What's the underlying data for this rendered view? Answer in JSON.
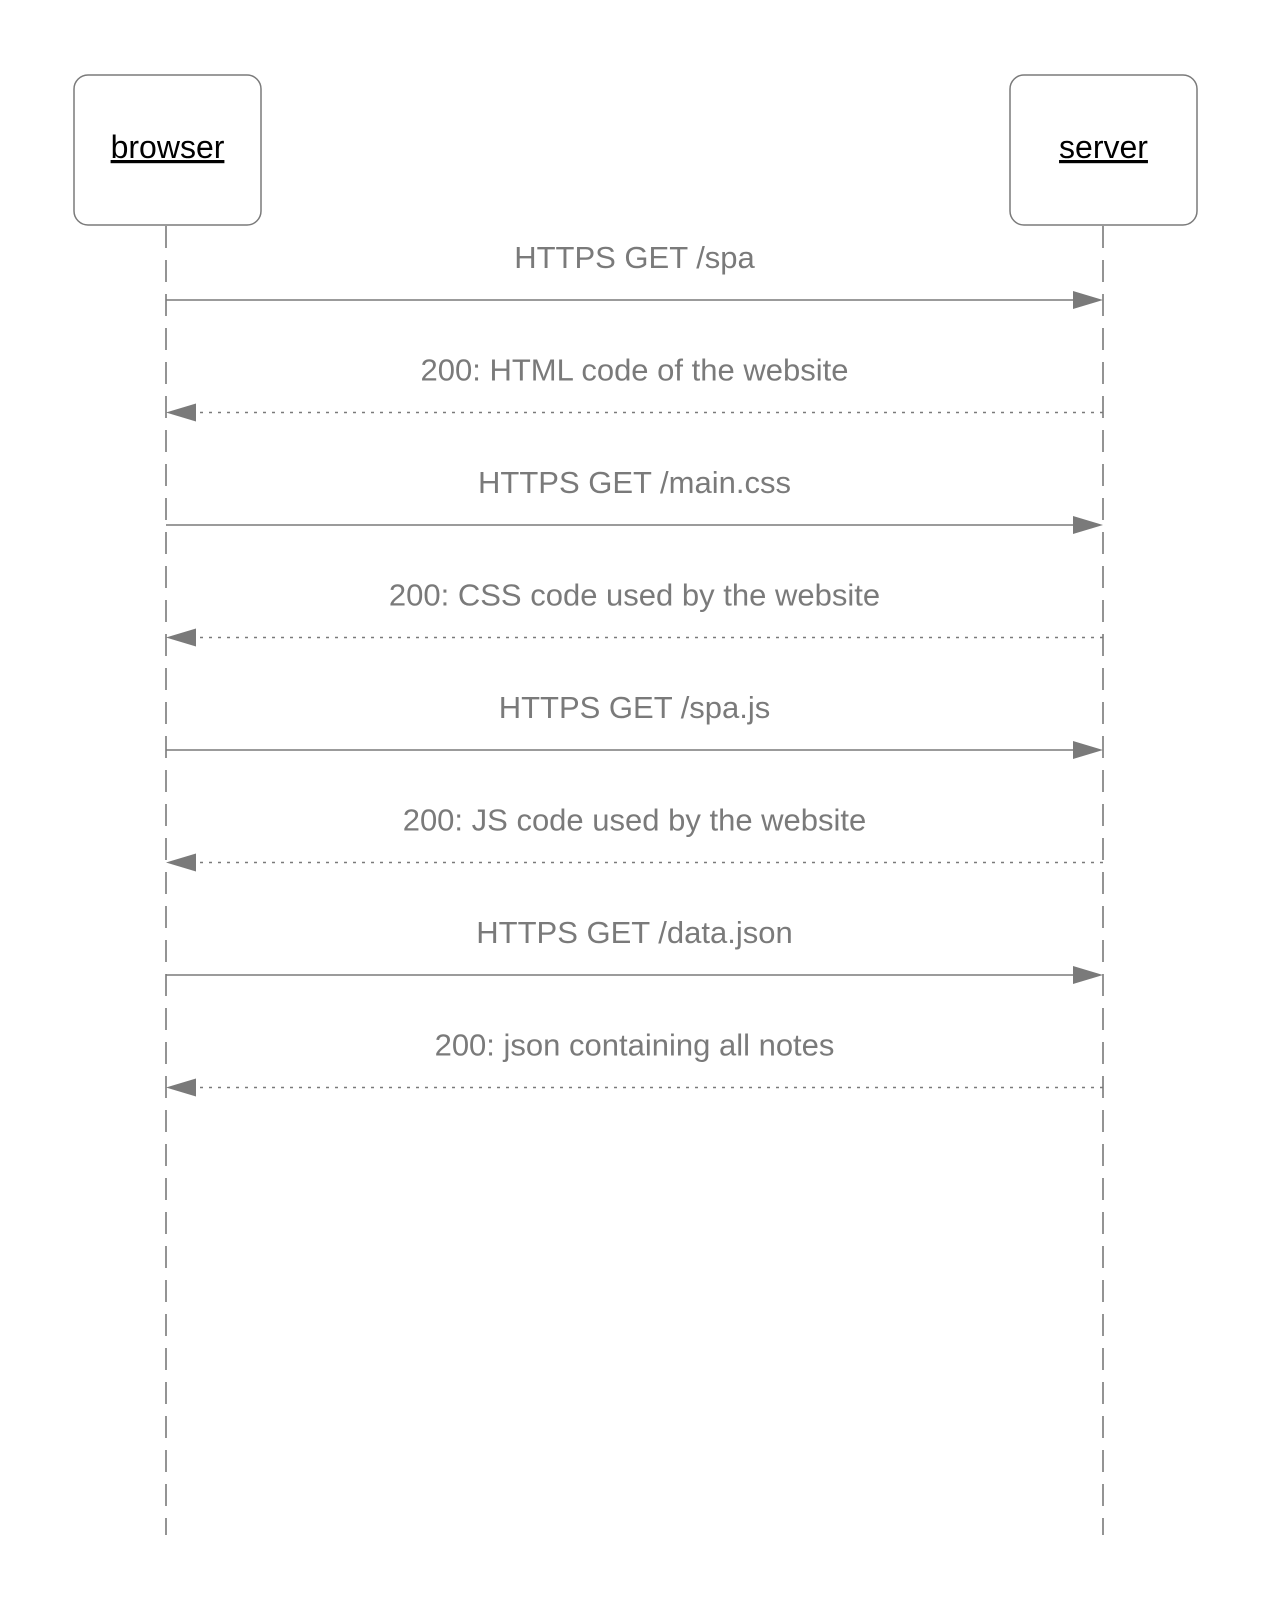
{
  "participants": [
    {
      "id": "browser",
      "label": "browser"
    },
    {
      "id": "server",
      "label": "server"
    }
  ],
  "messages": [
    {
      "from": "browser",
      "to": "server",
      "style": "solid",
      "label": "HTTPS GET /spa"
    },
    {
      "from": "server",
      "to": "browser",
      "style": "dotted",
      "label": "200: HTML code of the website"
    },
    {
      "from": "browser",
      "to": "server",
      "style": "solid",
      "label": "HTTPS GET /main.css"
    },
    {
      "from": "server",
      "to": "browser",
      "style": "dotted",
      "label": "200: CSS code used by the website"
    },
    {
      "from": "browser",
      "to": "server",
      "style": "solid",
      "label": "HTTPS GET /spa.js"
    },
    {
      "from": "server",
      "to": "browser",
      "style": "dotted",
      "label": "200: JS code used by the website"
    },
    {
      "from": "browser",
      "to": "server",
      "style": "solid",
      "label": "HTTPS GET /data.json"
    },
    {
      "from": "server",
      "to": "browser",
      "style": "dotted",
      "label": "200: json containing all notes"
    }
  ],
  "colors": {
    "line": "#7a7a7a",
    "box_border": "#7a7a7a",
    "actor_text": "#000000",
    "message_text": "#7a7a7a",
    "background": "#ffffff"
  }
}
